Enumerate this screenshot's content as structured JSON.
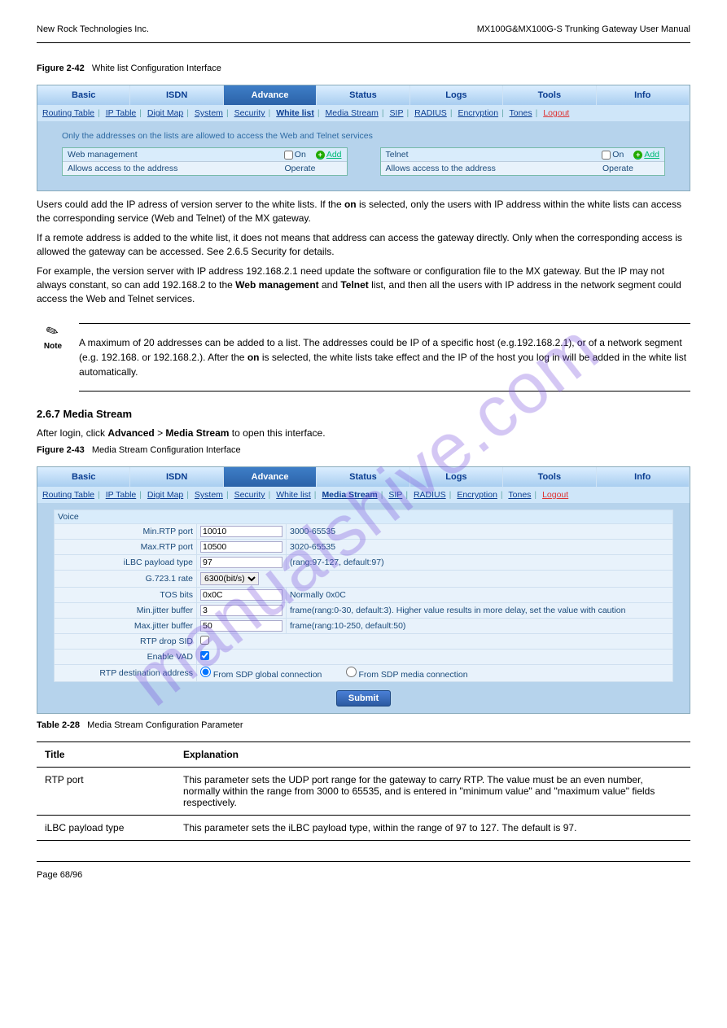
{
  "header": {
    "left": "New Rock Technologies Inc.",
    "right": "MX100G&MX100G-S Trunking Gateway User Manual"
  },
  "footer": {
    "left": "Page 68/96",
    "right": ""
  },
  "watermark": "manualshive.com",
  "fig1": {
    "caption_prefix": "Figure 2-42",
    "caption": "White list Configuration Interface"
  },
  "panel1": {
    "tabs": [
      "Basic",
      "ISDN",
      "Advance",
      "Status",
      "Logs",
      "Tools",
      "Info"
    ],
    "active_tab": 2,
    "subnav": [
      "Routing Table",
      "IP Table",
      "Digit Map",
      "System",
      "Security",
      "White list",
      "Media Stream",
      "SIP",
      "RADIUS",
      "Encryption",
      "Tones"
    ],
    "subnav_active": 5,
    "logout": "Logout",
    "hint": "Only the addresses on the lists are allowed to access the Web and Telnet services",
    "web": {
      "title": "Web management",
      "on": "On",
      "add": "Add",
      "col1": "Allows access to the address",
      "col2": "Operate"
    },
    "telnet": {
      "title": "Telnet",
      "on": "On",
      "add": "Add",
      "col1": "Allows access to the address",
      "col2": "Operate"
    }
  },
  "para": {
    "p1_a": "Users could add the IP adress of version server to the white lists. If the ",
    "p1_b": "on",
    "p1_c": " is selected, only the users with IP address within the white lists can access the corresponding service (Web and Telnet) of the MX gateway.",
    "p2": "If a remote address is added to the white list, it does not means that address can access the gateway directly. Only when the corresponding access is allowed the gateway can be accessed. See 2.6.5 Security for details.",
    "p3_a": "For example, the version server with IP address 192.168.2.1 need update the software or configuration file to the MX gateway. But the IP may not always constant, so can add 192.168.2 to the ",
    "p3_b": "Web management",
    "p3_c": " and ",
    "p3_d": "Telnet",
    "p3_e": " list, and then all the users with IP address in the network segment could access the Web and Telnet services."
  },
  "note": {
    "label": "Note",
    "text_a": "A maximum of 20 addresses can be added to a list. The addresses could be IP of a specific host (e.g.192.168.2.1), or of a network segment (e.g. 192.168. or 192.168.2.). After the ",
    "text_b": "on",
    "text_c": " is selected, the white lists take effect and the IP of the host you log in will be added in the white list automatically."
  },
  "section2": {
    "heading": "2.6.7 Media Stream",
    "lead_a": "After login, click ",
    "lead_b": "Advanced",
    "lead_c": " > ",
    "lead_d": "Media Stream",
    "lead_e": " to open this interface.",
    "fig_caption_prefix": "Figure 2-43",
    "fig_caption": "Media Stream Configuration Interface"
  },
  "panel2": {
    "tabs": [
      "Basic",
      "ISDN",
      "Advance",
      "Status",
      "Logs",
      "Tools",
      "Info"
    ],
    "active_tab": 2,
    "subnav": [
      "Routing Table",
      "IP Table",
      "Digit Map",
      "System",
      "Security",
      "White list",
      "Media Stream",
      "SIP",
      "RADIUS",
      "Encryption",
      "Tones"
    ],
    "subnav_active": 6,
    "logout": "Logout",
    "section_title": "Voice",
    "rows": {
      "min_rtp": {
        "label": "Min.RTP port",
        "value": "10010",
        "hint": "3000-65535"
      },
      "max_rtp": {
        "label": "Max.RTP port",
        "value": "10500",
        "hint": "3020-65535"
      },
      "ilbc": {
        "label": "iLBC payload type",
        "value": "97",
        "hint": "(rang:97-127, default:97)"
      },
      "g723": {
        "label": "G.723.1 rate",
        "selected": "6300(bit/s)"
      },
      "tos": {
        "label": "TOS bits",
        "value": "0x0C",
        "hint": "Normally 0x0C"
      },
      "minjb": {
        "label": "Min.jitter buffer",
        "value": "3",
        "hint": "frame(rang:0-30, default:3). Higher value results in more delay, set the value with caution"
      },
      "maxjb": {
        "label": "Max.jitter buffer",
        "value": "50",
        "hint": "frame(rang:10-250, default:50)"
      },
      "dropsid": {
        "label": "RTP drop SID",
        "checked": false
      },
      "vad": {
        "label": "Enable VAD",
        "checked": true
      },
      "rtpdest": {
        "label": "RTP destination address",
        "opt1": "From SDP global connection",
        "opt2": "From SDP media connection"
      }
    },
    "submit": "Submit"
  },
  "deftable": {
    "caption_prefix": "Table 2-28",
    "caption": "Media Stream Configuration Parameter",
    "head": {
      "c1": "Title",
      "c2": "Explanation"
    },
    "rows": [
      {
        "k": "RTP port",
        "v": "This parameter sets the UDP port range for the gateway to carry RTP. The value must be an even number, normally within the range from 3000 to 65535, and is entered in \"minimum value\" and \"maximum value\" fields respectively."
      },
      {
        "k": "iLBC payload type",
        "v": "This parameter sets the iLBC payload type, within the range of 97 to 127. The default is 97."
      }
    ]
  }
}
